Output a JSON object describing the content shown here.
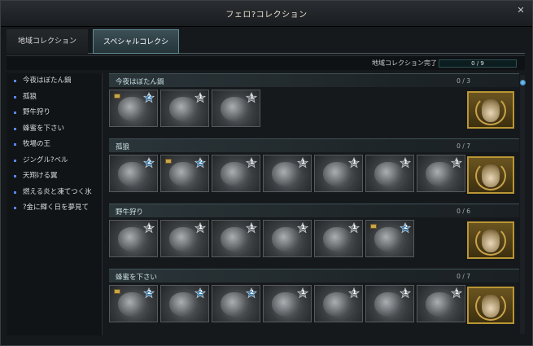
{
  "window": {
    "title": "フェロ?コレクション",
    "close_icon": "close-icon"
  },
  "tabs": [
    {
      "label": "地域コレクション",
      "active": false
    },
    {
      "label": "スペシャルコレクション",
      "active": true
    }
  ],
  "summary": {
    "label": "地域コレクション完了",
    "count": "0 / 9",
    "progress": 0
  },
  "sidebar": {
    "items": [
      {
        "label": "今夜はぼたん鍋"
      },
      {
        "label": "孤狼"
      },
      {
        "label": "野牛狩り"
      },
      {
        "label": "蜂蜜を下さい"
      },
      {
        "label": "牧場の王"
      },
      {
        "label": "ジングル?ベル"
      },
      {
        "label": "天翔ける翼"
      },
      {
        "label": "燃える炎と凍てつく氷"
      },
      {
        "label": "?金に輝く日を夢見て"
      }
    ]
  },
  "groups": [
    {
      "title": "今夜はぼたん鍋",
      "progress": "0 / 3",
      "cards": [
        {
          "star": "2",
          "blue": true,
          "book": true
        },
        {
          "star": "1",
          "blue": false,
          "book": false
        },
        {
          "star": "1",
          "blue": false,
          "book": false
        }
      ]
    },
    {
      "title": "孤狼",
      "progress": "0 / 7",
      "cards": [
        {
          "star": "2",
          "blue": true,
          "book": false
        },
        {
          "star": "2",
          "blue": true,
          "book": true
        },
        {
          "star": "1",
          "blue": false,
          "book": false
        },
        {
          "star": "1",
          "blue": false,
          "book": false
        },
        {
          "star": "1",
          "blue": false,
          "book": false
        },
        {
          "star": "1",
          "blue": false,
          "book": false
        },
        {
          "star": "1",
          "blue": false,
          "book": false
        }
      ]
    },
    {
      "title": "野牛狩り",
      "progress": "0 / 6",
      "cards": [
        {
          "star": "1",
          "blue": false,
          "book": false
        },
        {
          "star": "1",
          "blue": false,
          "book": false
        },
        {
          "star": "1",
          "blue": false,
          "book": false
        },
        {
          "star": "1",
          "blue": false,
          "book": false
        },
        {
          "star": "1",
          "blue": false,
          "book": false
        },
        {
          "star": "2",
          "blue": true,
          "book": true
        }
      ]
    },
    {
      "title": "蜂蜜を下さい",
      "progress": "0 / 7",
      "cards": [
        {
          "star": "2",
          "blue": true,
          "book": true
        },
        {
          "star": "2",
          "blue": true,
          "book": false
        },
        {
          "star": "2",
          "blue": true,
          "book": false
        },
        {
          "star": "1",
          "blue": false,
          "book": false
        },
        {
          "star": "1",
          "blue": false,
          "book": false
        },
        {
          "star": "1",
          "blue": false,
          "book": false
        },
        {
          "star": "1",
          "blue": false,
          "book": false
        }
      ]
    }
  ],
  "colors": {
    "accent_blue_star": "#3f7fae",
    "gray_star": "#7a7e82",
    "reward_gold": "#b99634",
    "bullet": "#5a86ff"
  }
}
